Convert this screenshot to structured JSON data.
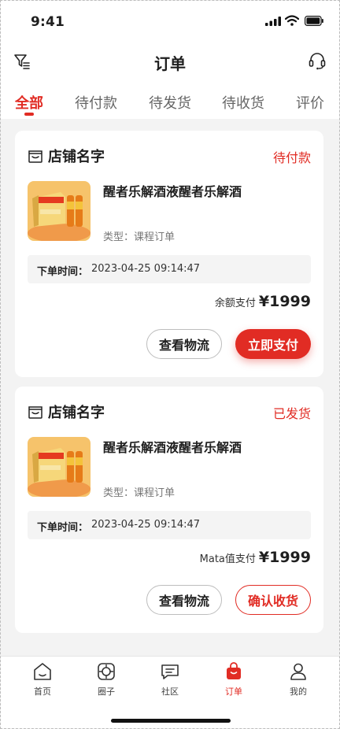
{
  "status_bar": {
    "time": "9:41"
  },
  "header": {
    "title": "订单",
    "filter_icon": "filter-icon",
    "service_icon": "customer-service-icon"
  },
  "tabs": [
    {
      "label": "全部",
      "active": true
    },
    {
      "label": "待付款",
      "active": false
    },
    {
      "label": "待发货",
      "active": false
    },
    {
      "label": "待收货",
      "active": false
    },
    {
      "label": "评价",
      "active": false
    }
  ],
  "orders": [
    {
      "shop_name": "店铺名字",
      "status": "待付款",
      "product_name": "醒者乐解酒液醒者乐解酒",
      "product_type": "类型：课程订单",
      "time_label": "下单时间：",
      "time_value": "2023-04-25 09:14:47",
      "pay_label": "余额支付",
      "pay_amount": "¥1999",
      "btn_secondary": "查看物流",
      "btn_primary": "立即支付"
    },
    {
      "shop_name": "店铺名字",
      "status": "已发货",
      "product_name": "醒者乐解酒液醒者乐解酒",
      "product_type": "类型：课程订单",
      "time_label": "下单时间：",
      "time_value": "2023-04-25 09:14:47",
      "pay_label": "Mata值支付",
      "pay_amount": "¥1999",
      "btn_secondary": "查看物流",
      "btn_primary": "确认收货"
    }
  ],
  "bottom_nav": [
    {
      "label": "首页",
      "icon": "home-icon",
      "active": false
    },
    {
      "label": "圈子",
      "icon": "circle-icon",
      "active": false
    },
    {
      "label": "社区",
      "icon": "community-icon",
      "active": false
    },
    {
      "label": "订单",
      "icon": "order-bag-icon",
      "active": true
    },
    {
      "label": "我的",
      "icon": "profile-icon",
      "active": false
    }
  ],
  "colors": {
    "accent": "#e12c24",
    "background": "#f3f3f3",
    "card": "#ffffff"
  }
}
